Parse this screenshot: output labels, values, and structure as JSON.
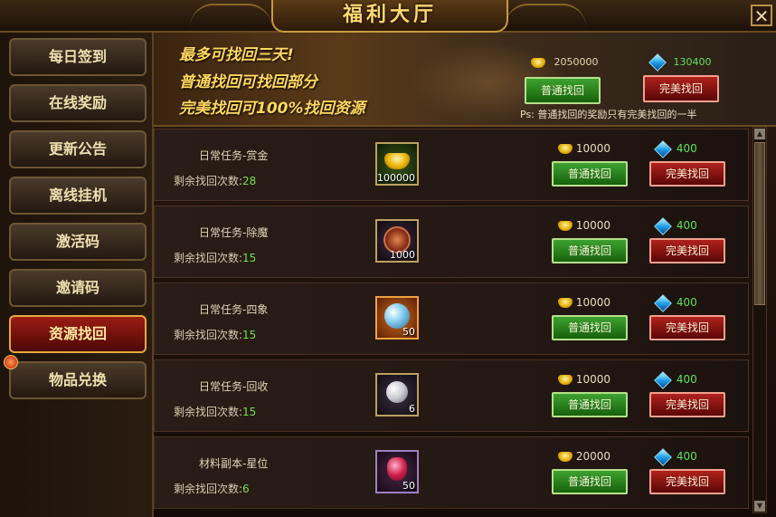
{
  "window": {
    "title": "福利大厅",
    "close_label": "✕"
  },
  "sidebar": {
    "items": [
      {
        "label": "每日签到",
        "active": false
      },
      {
        "label": "在线奖励",
        "active": false
      },
      {
        "label": "更新公告",
        "active": false
      },
      {
        "label": "离线挂机",
        "active": false
      },
      {
        "label": "激活码",
        "active": false
      },
      {
        "label": "邀请码",
        "active": false
      },
      {
        "label": "资源找回",
        "active": true
      },
      {
        "label": "物品兑换",
        "active": false
      }
    ]
  },
  "banner": {
    "line1": "最多可找回三天!",
    "line2": "普通找回可找回部分",
    "line3": "完美找回可100%找回资源",
    "gold_amount": "2050000",
    "diamond_amount": "130400",
    "normal_button": "普通找回",
    "perfect_button": "完美找回",
    "note": "Ps: 普通找回的奖励只有完美找回的一半"
  },
  "rows": [
    {
      "name": "日常任务-赏金",
      "remaining_label": "剩余找回次数:",
      "remaining": "28",
      "item_icon": "gold-ingot-icon",
      "item_count": "100000",
      "gold_cost": "10000",
      "diamond_cost": "400",
      "normal_button": "普通找回",
      "perfect_button": "完美找回"
    },
    {
      "name": "日常任务-除魔",
      "remaining_label": "剩余找回次数:",
      "remaining": "15",
      "item_icon": "bronze-medal-icon",
      "item_count": "1000",
      "gold_cost": "10000",
      "diamond_cost": "400",
      "normal_button": "普通找回",
      "perfect_button": "完美找回"
    },
    {
      "name": "日常任务-四象",
      "remaining_label": "剩余找回次数:",
      "remaining": "15",
      "item_icon": "crystal-orb-icon",
      "item_count": "50",
      "gold_cost": "10000",
      "diamond_cost": "400",
      "normal_button": "普通找回",
      "perfect_button": "完美找回"
    },
    {
      "name": "日常任务-回收",
      "remaining_label": "剩余找回次数:",
      "remaining": "15",
      "item_icon": "pearl-icon",
      "item_count": "6",
      "gold_cost": "10000",
      "diamond_cost": "400",
      "normal_button": "普通找回",
      "perfect_button": "完美找回"
    },
    {
      "name": "材料副本-星位",
      "remaining_label": "剩余找回次数:",
      "remaining": "6",
      "item_icon": "red-gem-icon",
      "item_count": "50",
      "gold_cost": "20000",
      "diamond_cost": "400",
      "normal_button": "普通找回",
      "perfect_button": "完美找回"
    }
  ],
  "colors": {
    "gold_text": "#ffd860",
    "remaining_number": "#70e050",
    "active_tab": "#9a1c14",
    "normal_button": "#3ea230",
    "perfect_button": "#b0221c"
  }
}
